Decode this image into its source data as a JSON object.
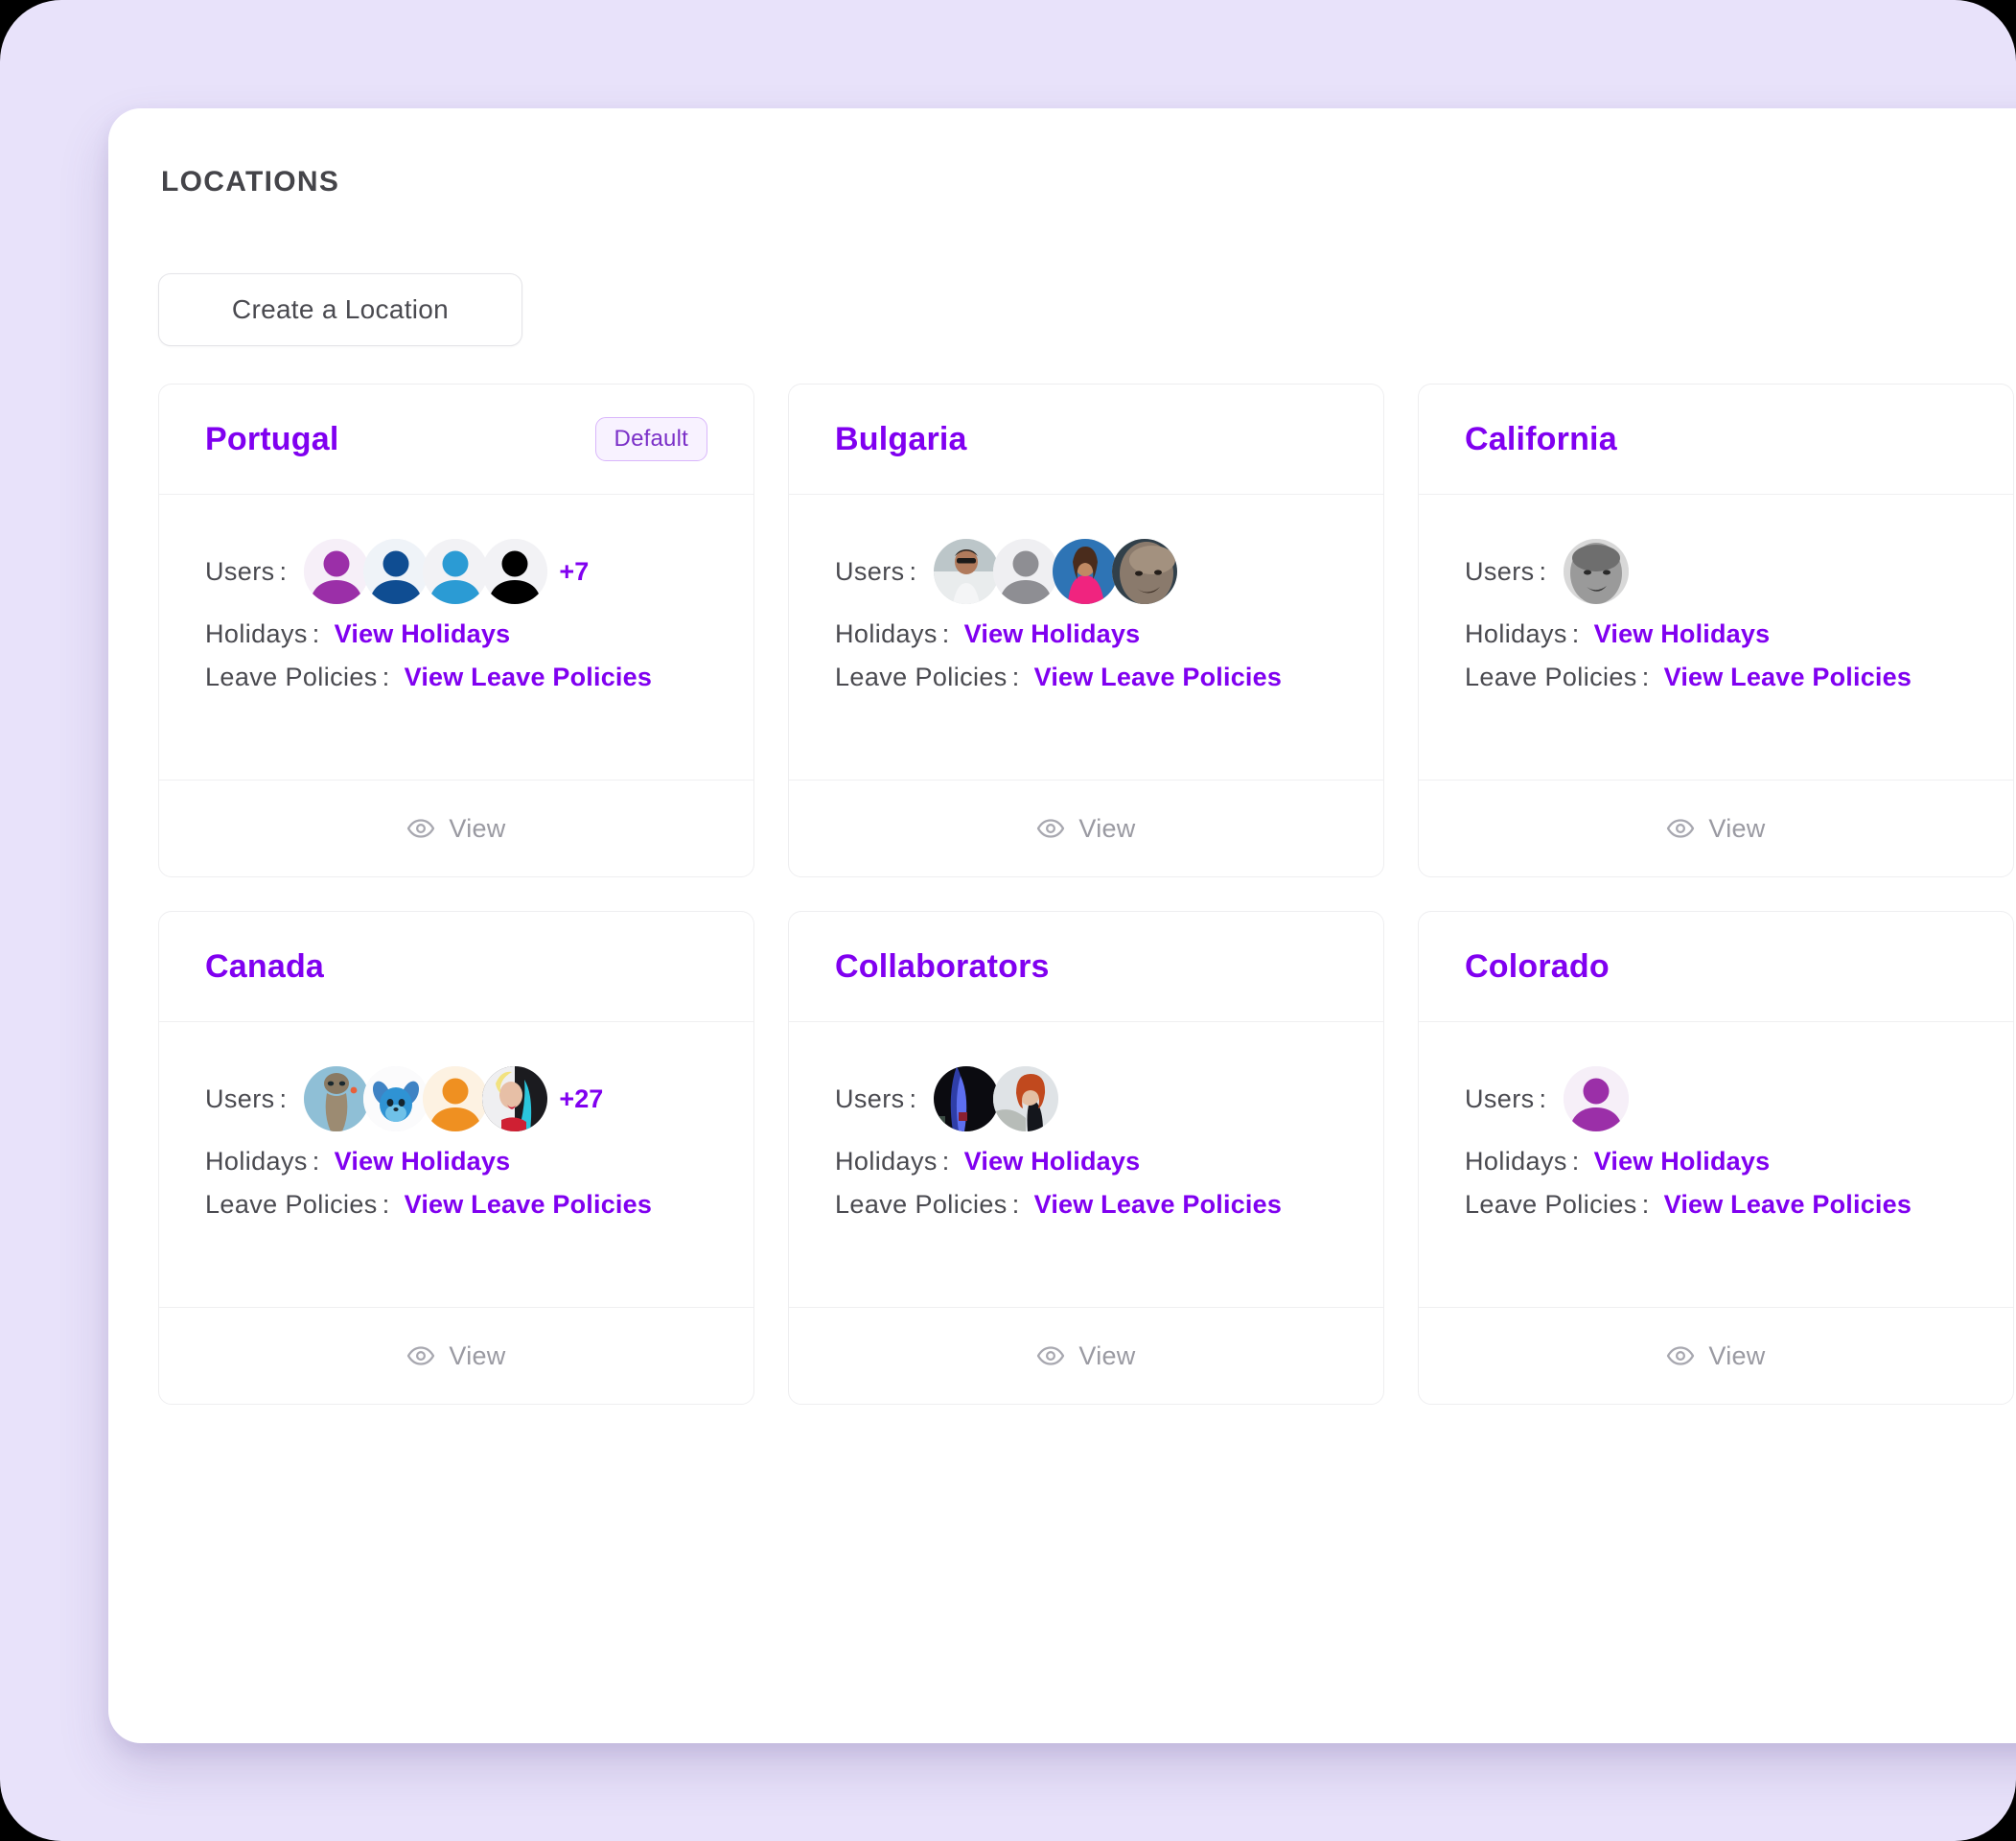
{
  "theme": {
    "outer_background": "#E8E2FA",
    "panel_background": "#FFFFFF",
    "accent_purple": "#8000F0",
    "label_grey": "#4A4A50",
    "muted_grey": "#9A9AA2",
    "border_grey": "#EEEEF0",
    "badge_background": "#F8F2FF",
    "badge_border": "#D9B6FB",
    "badge_text": "#7B30C8"
  },
  "header": {
    "title": "LOCATIONS"
  },
  "toolbar": {
    "create_location_label": "Create a Location"
  },
  "labels": {
    "users": "Users",
    "holidays": "Holidays",
    "leave_policies": "Leave Policies",
    "colon": ":",
    "view_holidays_link": "View Holidays",
    "view_leave_policies_link": "View Leave Policies",
    "view_footer": "View",
    "default_badge": "Default"
  },
  "icons": {
    "eye": "eye-icon",
    "person": "person-silhouette-icon"
  },
  "cards": [
    {
      "name": "Portugal",
      "is_default": true,
      "default_badge": "Default",
      "users_overflow": "+7",
      "avatars": [
        {
          "name": "avatar-purple-silhouette",
          "kind": "silhouette",
          "color": "#9B2FA8",
          "bg": "#F6EFF8"
        },
        {
          "name": "avatar-navy-silhouette",
          "kind": "silhouette",
          "color": "#0F4D92",
          "bg": "#EFF3F8"
        },
        {
          "name": "avatar-blue-silhouette",
          "kind": "silhouette",
          "color": "#2B9BD4",
          "bg": "#F2F2F5"
        },
        {
          "name": "avatar-black-silhouette",
          "kind": "silhouette",
          "color": "#000000",
          "bg": "#F2F2F5"
        }
      ],
      "holidays_link": "View Holidays",
      "leave_policies_link": "View Leave Policies",
      "footer": "View"
    },
    {
      "name": "Bulgaria",
      "is_default": false,
      "users_overflow": "",
      "avatars": [
        {
          "name": "avatar-photo-man-sunglasses",
          "kind": "photo",
          "photo": "man-sunglasses"
        },
        {
          "name": "avatar-grey-silhouette",
          "kind": "silhouette",
          "color": "#8E8E93",
          "bg": "#EFEFF2"
        },
        {
          "name": "avatar-photo-woman-pink",
          "kind": "photo",
          "photo": "woman-pink-top"
        },
        {
          "name": "avatar-photo-bald-man",
          "kind": "photo",
          "photo": "bald-man-face"
        }
      ],
      "holidays_link": "View Holidays",
      "leave_policies_link": "View Leave Policies",
      "footer": "View"
    },
    {
      "name": "California",
      "is_default": false,
      "users_overflow": "",
      "avatars": [
        {
          "name": "avatar-photo-grey-face",
          "kind": "photo",
          "photo": "greyscale-man-face"
        }
      ],
      "holidays_link": "View Holidays",
      "leave_policies_link": "View Leave Policies",
      "footer": "View",
      "clipped": true
    },
    {
      "name": "Canada",
      "is_default": false,
      "users_overflow": "+27",
      "avatars": [
        {
          "name": "avatar-photo-et",
          "kind": "photo",
          "photo": "et-alien"
        },
        {
          "name": "avatar-photo-stitch",
          "kind": "photo",
          "photo": "stitch"
        },
        {
          "name": "avatar-orange-silhouette",
          "kind": "silhouette",
          "color": "#EF9021",
          "bg": "#FDF2E2"
        },
        {
          "name": "avatar-photo-harley-quinn",
          "kind": "photo",
          "photo": "harley-quinn"
        }
      ],
      "holidays_link": "View Holidays",
      "leave_policies_link": "View Leave Policies",
      "footer": "View"
    },
    {
      "name": "Collaborators",
      "is_default": false,
      "users_overflow": "",
      "avatars": [
        {
          "name": "avatar-photo-dark-figure",
          "kind": "photo",
          "photo": "dark-blue-figure"
        },
        {
          "name": "avatar-photo-red-hair-woman",
          "kind": "photo",
          "photo": "red-hair-woman"
        }
      ],
      "holidays_link": "View Holidays",
      "leave_policies_link": "View Leave Policies",
      "footer": "View"
    },
    {
      "name": "Colorado",
      "is_default": false,
      "users_overflow": "",
      "avatars": [
        {
          "name": "avatar-purple-silhouette",
          "kind": "silhouette",
          "color": "#9B2FA8",
          "bg": "#F6EFF8"
        }
      ],
      "holidays_link": "View Holidays",
      "leave_policies_link": "View Leave Policies",
      "footer": "View",
      "clipped": true
    }
  ]
}
